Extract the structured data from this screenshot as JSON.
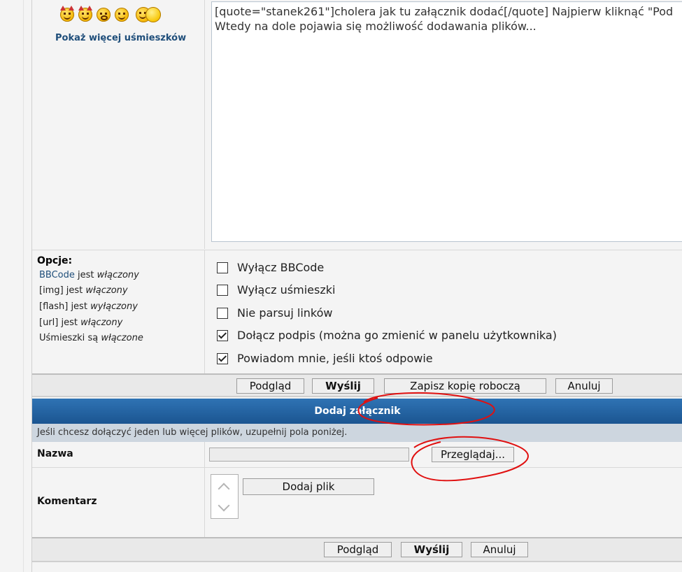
{
  "smilies": {
    "icons": [
      "devil-smiley-icon",
      "devil-smiley-icon",
      "eyes-closed-smiley-icon",
      "wink-smiley-icon",
      "kiss-smiley-icon"
    ],
    "more_label": "Pokaż więcej uśmieszków"
  },
  "message": {
    "text": "[quote=\"stanek261\"]cholera jak tu załącznik dodać[/quote] Najpierw kliknąć \"Pod\nWtedy na dole pojawia się możliwość dodawania plików..."
  },
  "options": {
    "title": "Opcje:",
    "status": [
      {
        "key": "BBCode",
        "middle": " jest ",
        "value": "włączony",
        "link": true
      },
      {
        "key": "[img]",
        "middle": " jest ",
        "value": "włączony",
        "link": false
      },
      {
        "key": "[flash]",
        "middle": " jest ",
        "value": "wyłączony",
        "link": false
      },
      {
        "key": "[url]",
        "middle": " jest ",
        "value": "włączony",
        "link": false
      },
      {
        "key": "Uśmieszki",
        "middle": " są ",
        "value": "włączone",
        "link": false
      }
    ],
    "checkboxes": [
      {
        "label": "Wyłącz BBCode",
        "checked": false
      },
      {
        "label": "Wyłącz uśmieszki",
        "checked": false
      },
      {
        "label": "Nie parsuj linków",
        "checked": false
      },
      {
        "label": "Dołącz podpis (można go zmienić w panelu użytkownika)",
        "checked": true
      },
      {
        "label": "Powiadom mnie, jeśli ktoś odpowie",
        "checked": true
      }
    ]
  },
  "buttons_top": {
    "preview": "Podgląd",
    "submit": "Wyślij",
    "save_draft": "Zapisz kopię roboczą",
    "cancel": "Anuluj"
  },
  "attachment": {
    "header": "Dodaj załącznik",
    "hint": "Jeśli chcesz dołączyć jeden lub więcej plików, uzupełnij pola poniżej.",
    "name_label": "Nazwa",
    "browse": "Przeglądaj...",
    "comment_label": "Komentarz",
    "add_file": "Dodaj plik"
  },
  "buttons_bottom": {
    "preview": "Podgląd",
    "submit": "Wyślij",
    "cancel": "Anuluj"
  },
  "colors": {
    "header_blue": "#1b5591",
    "link_blue": "#1f4e7a",
    "annotation_red": "#e01010"
  }
}
